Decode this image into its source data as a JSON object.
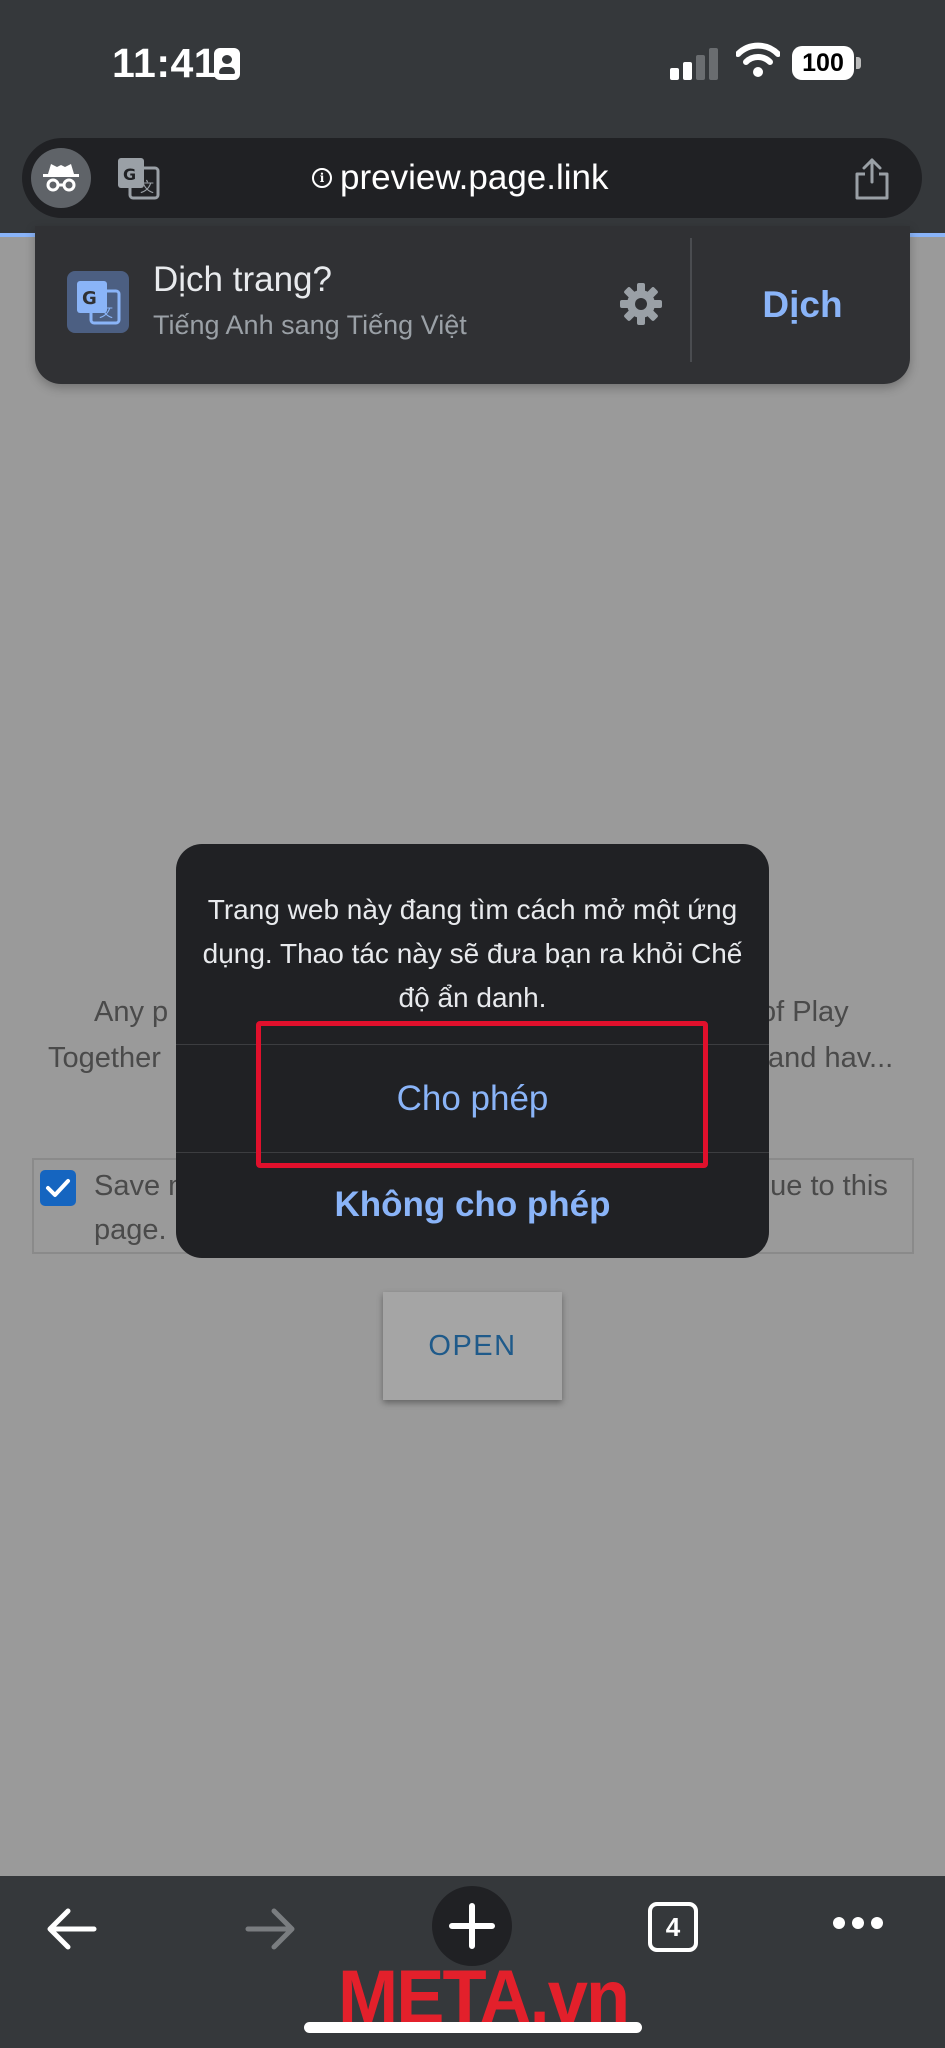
{
  "status_bar": {
    "time": "11:41",
    "battery": "100"
  },
  "url_bar": {
    "url": "preview.page.link"
  },
  "translate_bar": {
    "title": "Dịch trang?",
    "subtitle": "Tiếng Anh sang Tiếng Việt",
    "action_label": "Dịch"
  },
  "page": {
    "text_line1_left": "Any p",
    "text_line1_right": "of Play",
    "text_line2_left": "Together",
    "text_line2_right": "and hav...",
    "checkbox_left": "Save m",
    "checkbox_right": "nue to this",
    "checkbox_line2": "page.",
    "open_button": "OPEN"
  },
  "dialog": {
    "message": "Trang web này đang tìm cách mở một ứng dụng.  Thao tác này sẽ đưa bạn ra khỏi Chế độ ẩn danh.",
    "allow_label": "Cho phép",
    "deny_label": "Không cho phép"
  },
  "toolbar": {
    "tab_count": "4"
  },
  "watermark": {
    "text": "META.vn"
  },
  "colors": {
    "accent": "#8ab4f8",
    "highlight": "#e0102c",
    "chrome": "#35383b",
    "dialog": "#202124"
  }
}
